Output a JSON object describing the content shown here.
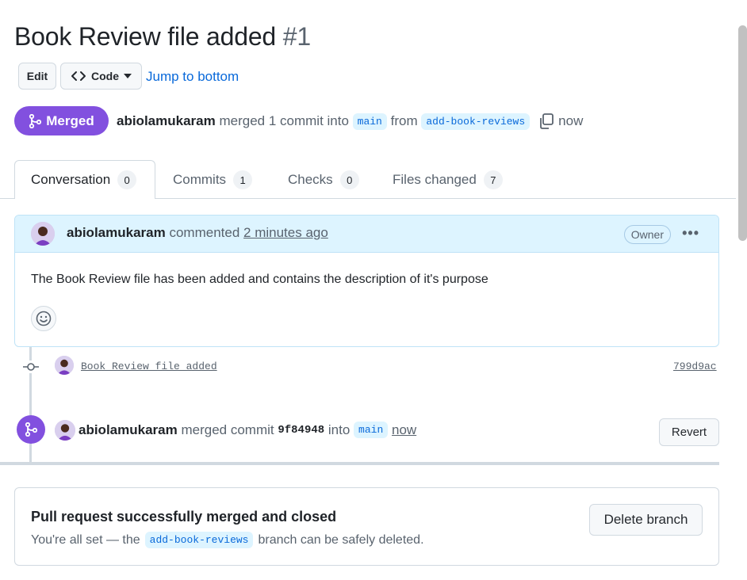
{
  "pr": {
    "title": "Book Review file added",
    "number": "#1",
    "edit_label": "Edit",
    "code_label": "Code",
    "jump_label": "Jump to bottom",
    "status": "Merged",
    "author": "abiolamukaram",
    "merged_text": "merged 1 commit into",
    "base_branch": "main",
    "from_text": "from",
    "head_branch": "add-book-reviews",
    "time": "now"
  },
  "tabs": [
    {
      "label": "Conversation",
      "count": "0"
    },
    {
      "label": "Commits",
      "count": "1"
    },
    {
      "label": "Checks",
      "count": "0"
    },
    {
      "label": "Files changed",
      "count": "7"
    }
  ],
  "comment": {
    "author": "abiolamukaram",
    "action": "commented",
    "time": "2 minutes ago",
    "role_badge": "Owner",
    "body": "The Book Review file has been added and contains the description of it's purpose"
  },
  "commit": {
    "message": "Book Review file added",
    "sha": "799d9ac"
  },
  "merge_event": {
    "author": "abiolamukaram",
    "action": "merged commit",
    "sha": "9f84948",
    "into_text": "into",
    "branch": "main",
    "time": "now",
    "revert_label": "Revert"
  },
  "merged_box": {
    "title": "Pull request successfully merged and closed",
    "sub_prefix": "You're all set — the",
    "branch": "add-book-reviews",
    "sub_suffix": "branch can be safely deleted.",
    "delete_label": "Delete branch"
  },
  "colors": {
    "merged_purple": "#8250df",
    "link_blue": "#0969da",
    "branch_bg": "#ddf4ff"
  },
  "icons": [
    "code-icon",
    "chevron-down-icon",
    "merge-icon",
    "copy-icon",
    "kebab-icon",
    "smiley-icon",
    "commit-icon"
  ]
}
